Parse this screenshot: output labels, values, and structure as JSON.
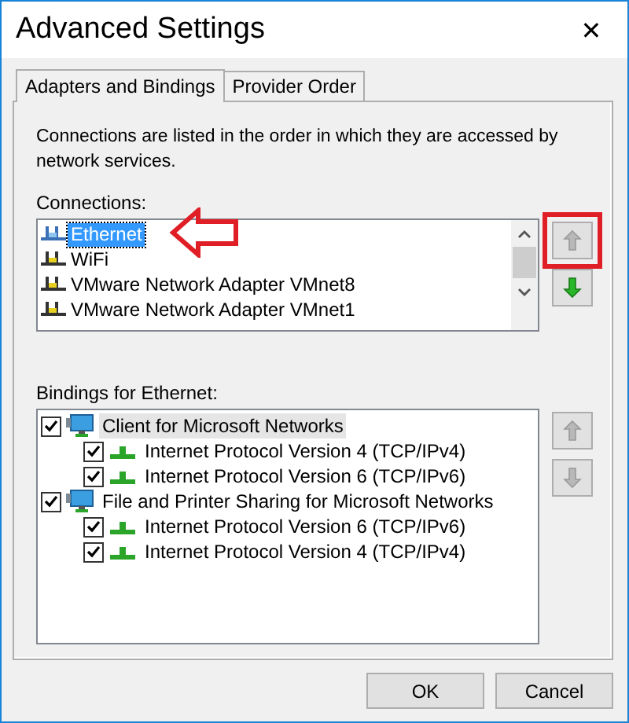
{
  "window": {
    "title": "Advanced Settings",
    "close": "✕"
  },
  "tabs": [
    {
      "label": "Adapters and Bindings",
      "selected": true
    },
    {
      "label": "Provider Order",
      "selected": false
    }
  ],
  "description": "Connections are listed in the order in which they are accessed by network services.",
  "connections": {
    "label": "Connections:",
    "items": [
      {
        "name": "Ethernet",
        "kind": "wired",
        "selected": true,
        "annotated": true
      },
      {
        "name": "WiFi",
        "kind": "wireless",
        "selected": false,
        "annotated": false
      },
      {
        "name": "VMware Network Adapter VMnet8",
        "kind": "wireless",
        "selected": false,
        "annotated": false
      },
      {
        "name": "VMware Network Adapter VMnet1",
        "kind": "wireless",
        "selected": false,
        "annotated": false
      }
    ],
    "move_up": {
      "disabled": true,
      "highlighted": true
    },
    "move_down": {
      "disabled": false,
      "highlighted": false
    }
  },
  "bindings": {
    "label": "Bindings for Ethernet:",
    "items": [
      {
        "name": "Client for Microsoft Networks",
        "checked": true,
        "selected": true,
        "children": [
          {
            "name": "Internet Protocol Version 4 (TCP/IPv4)",
            "checked": true,
            "selected": false
          },
          {
            "name": "Internet Protocol Version 6 (TCP/IPv6)",
            "checked": true,
            "selected": false
          }
        ]
      },
      {
        "name": "File and Printer Sharing for Microsoft Networks",
        "checked": true,
        "selected": false,
        "children": [
          {
            "name": "Internet Protocol Version 6 (TCP/IPv6)",
            "checked": true,
            "selected": false
          },
          {
            "name": "Internet Protocol Version 4 (TCP/IPv4)",
            "checked": true,
            "selected": false
          }
        ]
      }
    ],
    "move_up": {
      "disabled": true
    },
    "move_down": {
      "disabled": true
    }
  },
  "buttons": [
    "OK",
    "Cancel"
  ]
}
